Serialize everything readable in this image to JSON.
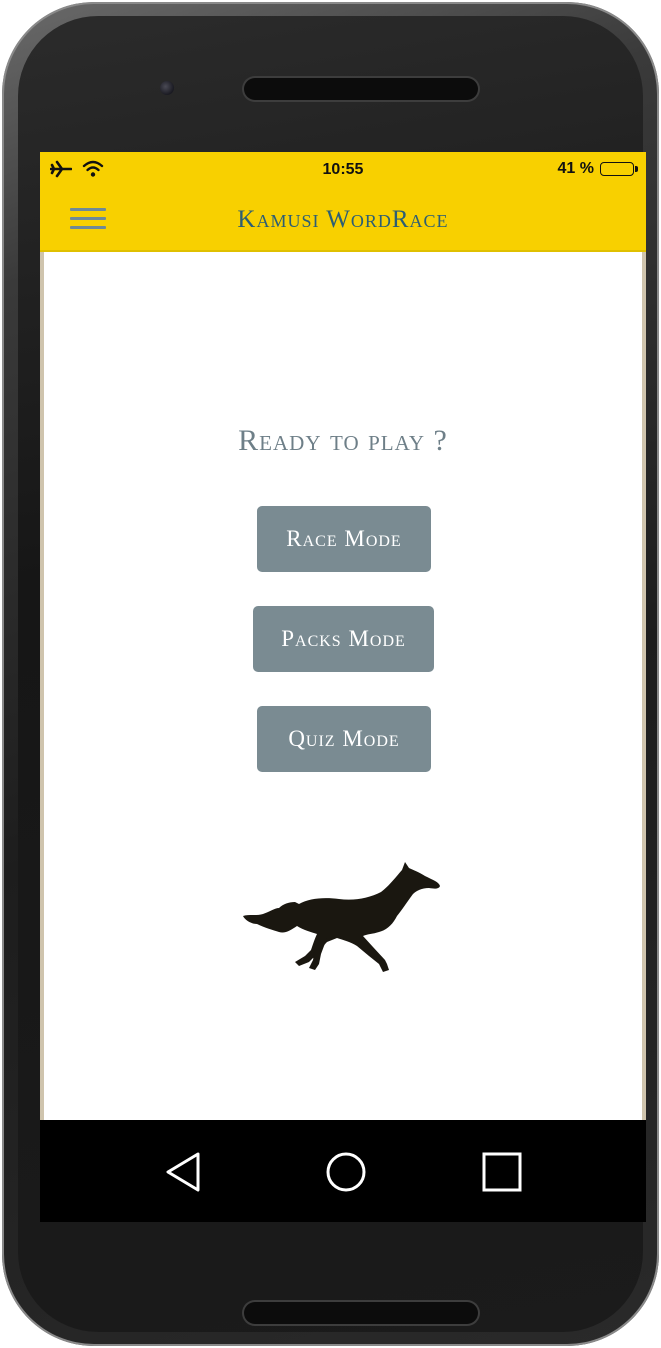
{
  "status_bar": {
    "time": "10:55",
    "battery": "41 %",
    "airplane_icon": "airplane-icon",
    "wifi_icon": "wifi-icon"
  },
  "app_bar": {
    "title": "Kamusi WordRace",
    "menu_icon": "hamburger-menu-icon"
  },
  "main": {
    "heading": "Ready to play ?",
    "buttons": [
      {
        "label": "Race Mode"
      },
      {
        "label": "Packs Mode"
      },
      {
        "label": "Quiz Mode"
      }
    ],
    "mascot": "running-horse-image"
  },
  "nav_bar": {
    "back_icon": "back-triangle-icon",
    "home_icon": "home-circle-icon",
    "recents_icon": "recents-square-icon"
  },
  "colors": {
    "app_bar": "#f8d000",
    "title": "#2c5e74",
    "button": "#7a8b92",
    "heading": "#6e7f88"
  }
}
